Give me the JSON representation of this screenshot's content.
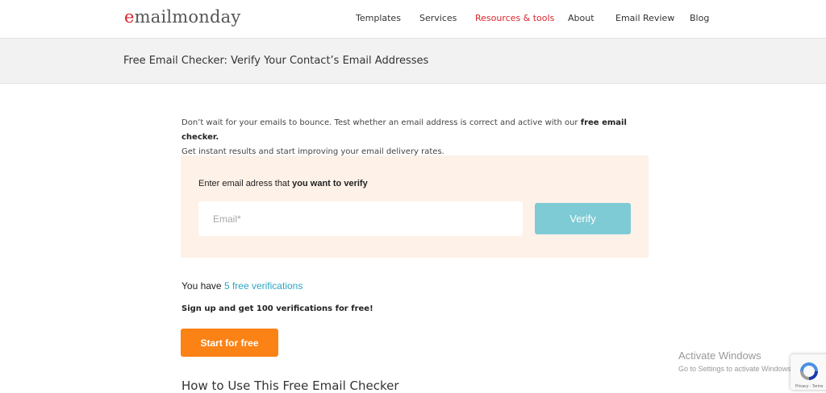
{
  "header": {
    "logo_first": "e",
    "logo_rest": "mailmonday",
    "nav": [
      {
        "label": "Templates",
        "active": false
      },
      {
        "label": "Services",
        "active": false
      },
      {
        "label": "Resources & tools",
        "active": true
      },
      {
        "label": "About",
        "active": false
      },
      {
        "label": "Email Review",
        "active": false
      },
      {
        "label": "Blog",
        "active": false
      }
    ]
  },
  "page": {
    "title": "Free Email Checker: Verify Your Contact’s Email Addresses"
  },
  "intro": {
    "text_before": "Don’t wait for your emails to bounce. Test whether an email address is correct and active with our ",
    "bold": "free email checker.",
    "line2": "Get instant results and start improving your email delivery rates."
  },
  "verify": {
    "label_start": "Enter email adress that ",
    "label_bold": "you want to verify",
    "email_placeholder": "Email*",
    "email_value": "",
    "button_label": "Verify"
  },
  "verifications": {
    "prefix": "You have ",
    "link": "5 free verifications",
    "signup_text": "Sign up and get 100 verifications for free!",
    "start_button": "Start for free"
  },
  "section": {
    "howto_title": "How to Use This Free Email Checker"
  },
  "watermark": {
    "title": "Activate Windows",
    "subtitle": "Go to Settings to activate Windows."
  },
  "recaptcha": {
    "links": "Privacy - Terms"
  },
  "colors": {
    "brand_red": "#d9262b",
    "box_bg": "#fdf1e8",
    "verify_button": "#7ecbd5",
    "start_button": "#fb8214",
    "link": "#2aa7c1"
  }
}
